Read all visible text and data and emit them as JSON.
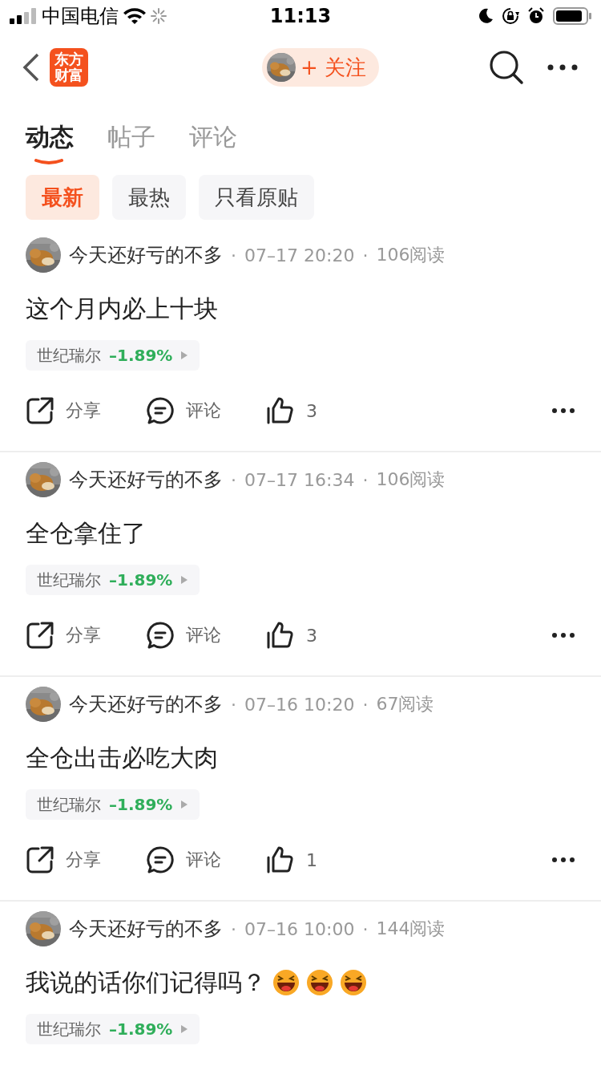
{
  "status_bar": {
    "carrier": "中国电信",
    "time": "11:13"
  },
  "nav": {
    "logo": [
      "东方",
      "财富"
    ],
    "follow_button": "+ 关注"
  },
  "tabs": [
    {
      "label": "动态",
      "selected": true
    },
    {
      "label": "帖子",
      "selected": false
    },
    {
      "label": "评论",
      "selected": false
    }
  ],
  "filters": [
    {
      "label": "最新",
      "selected": true
    },
    {
      "label": "最热",
      "selected": false
    },
    {
      "label": "只看原贴",
      "selected": false
    }
  ],
  "posts": [
    {
      "author": "今天还好亏的不多",
      "separators": [
        "·",
        "·"
      ],
      "time": "07–17 20:20",
      "reads": "106阅读",
      "text": "这个月内必上十块",
      "stock": {
        "name": "世纪瑞尔",
        "change": "–1.89%",
        "color": "#2fae5a"
      },
      "actions": {
        "share": "分享",
        "comment": "评论",
        "likes": "3"
      }
    },
    {
      "author": "今天还好亏的不多",
      "separators": [
        "·",
        "·"
      ],
      "time": "07–17 16:34",
      "reads": "106阅读",
      "text": "全仓拿住了",
      "stock": {
        "name": "世纪瑞尔",
        "change": "–1.89%",
        "color": "#2fae5a"
      },
      "actions": {
        "share": "分享",
        "comment": "评论",
        "likes": "3"
      }
    },
    {
      "author": "今天还好亏的不多",
      "separators": [
        "·",
        "·"
      ],
      "time": "07–16 10:20",
      "reads": "67阅读",
      "text": "全仓出击必吃大肉",
      "stock": {
        "name": "世纪瑞尔",
        "change": "–1.89%",
        "color": "#2fae5a"
      },
      "actions": {
        "share": "分享",
        "comment": "评论",
        "likes": "1"
      }
    },
    {
      "author": "今天还好亏的不多",
      "separators": [
        "·",
        "·"
      ],
      "time": "07–16 10:00",
      "reads": "144阅读",
      "text": "我说的话你们记得吗？",
      "emojis": [
        {
          "kind": "laugh"
        },
        {
          "kind": "laugh"
        },
        {
          "kind": "laugh"
        }
      ],
      "stock": {
        "name": "世纪瑞尔",
        "change": "–1.89%",
        "color": "#2fae5a"
      }
    }
  ]
}
